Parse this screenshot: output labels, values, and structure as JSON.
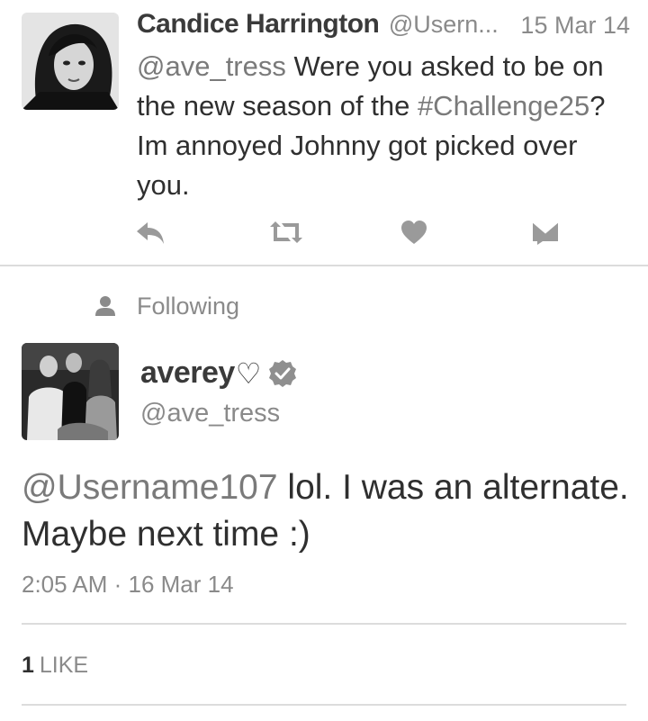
{
  "reply": {
    "display_name": "Candice Harrington",
    "handle": "@Usern...",
    "date": "15 Mar 14",
    "mention": "@ave_tress",
    "text_part1": " Were you asked to be on the new season of the ",
    "hashtag": "#Challenge25",
    "text_part2": "? Im annoyed Johnny got picked over you."
  },
  "actions": [
    "reply-icon",
    "retweet-icon",
    "heart-icon",
    "message-icon"
  ],
  "social_context": {
    "label": "Following",
    "icon": "person-icon"
  },
  "tweet": {
    "display_name": "averey",
    "name_suffix": "♡",
    "handle": "@ave_tress",
    "mention": "@Username107",
    "text": " lol. I was an alternate. Maybe next time :)",
    "timestamp": "2:05 AM · 16 Mar 14",
    "likes_count": "1",
    "likes_label": "LIKE"
  },
  "colors": {
    "text": "#2f2f2f",
    "muted": "#8a8a8a",
    "divider": "#dcdcdc",
    "icon": "#9a9a9a"
  }
}
